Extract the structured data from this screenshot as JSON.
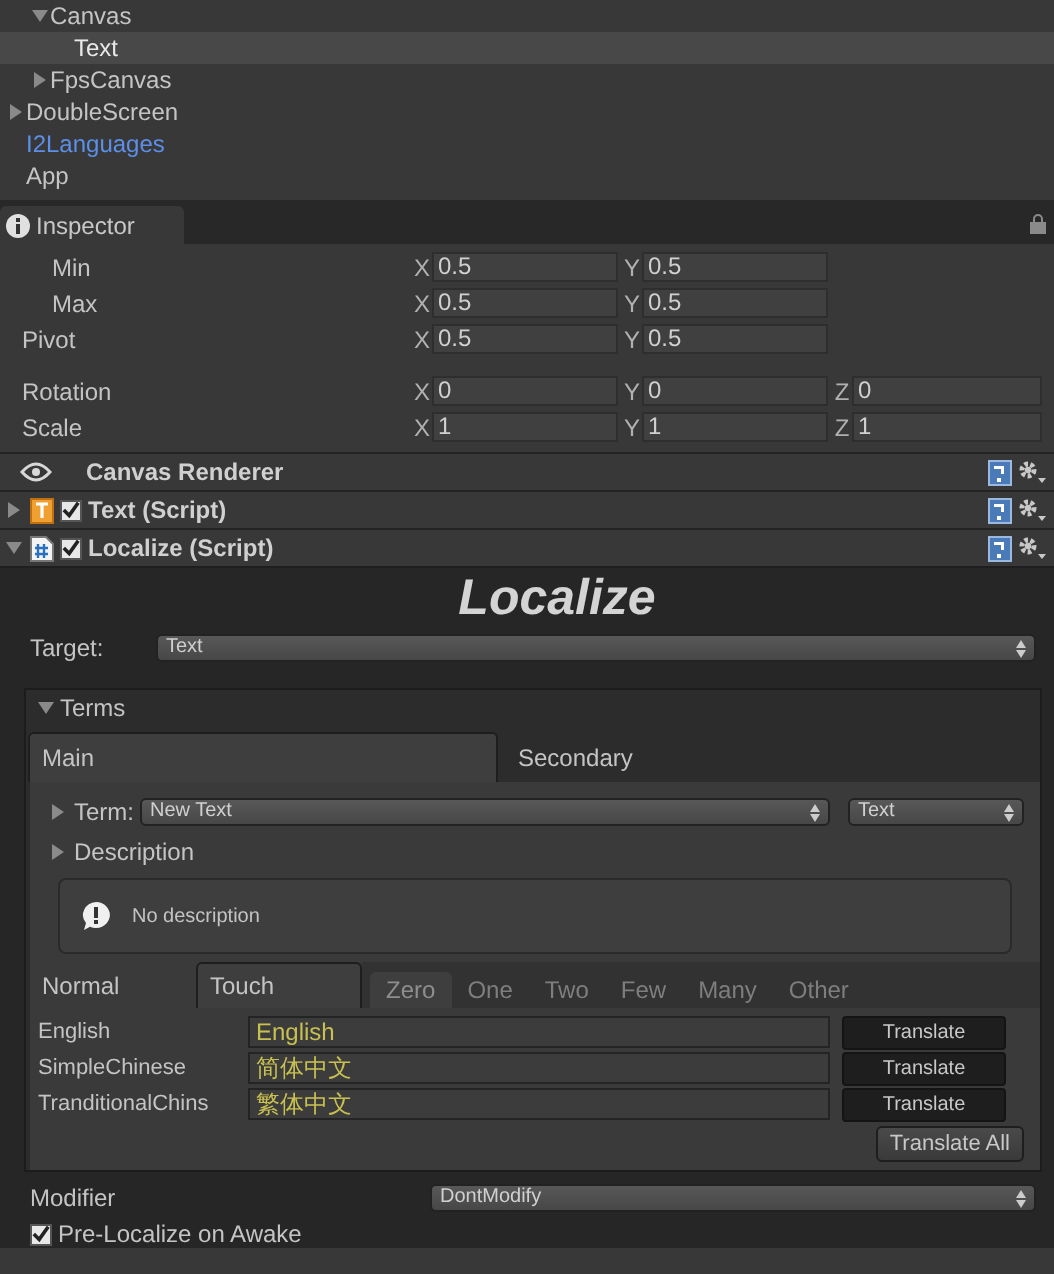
{
  "hierarchy": {
    "scrolled_children": [
      {
        "label": "Canvas",
        "expanded": true,
        "selected": false,
        "prefab": false,
        "children": [
          {
            "label": "Text",
            "selected": true,
            "prefab": false
          }
        ]
      },
      {
        "label": "FpsCanvas",
        "expanded": false,
        "selected": false,
        "prefab": false
      }
    ],
    "items": [
      {
        "label": "DoubleScreen",
        "expanded": false,
        "selected": false,
        "prefab": false
      },
      {
        "label": "I2Languages",
        "selected": false,
        "prefab": true
      },
      {
        "label": "App",
        "selected": false,
        "prefab": false
      }
    ]
  },
  "inspector_tab": {
    "label": "Inspector"
  },
  "transform_rows": [
    {
      "label": "Min",
      "indented": true,
      "fields": [
        {
          "axis": "X",
          "value": "0.5"
        },
        {
          "axis": "Y",
          "value": "0.5"
        }
      ]
    },
    {
      "label": "Max",
      "indented": true,
      "fields": [
        {
          "axis": "X",
          "value": "0.5"
        },
        {
          "axis": "Y",
          "value": "0.5"
        }
      ]
    },
    {
      "label": "Pivot",
      "indented": false,
      "fields": [
        {
          "axis": "X",
          "value": "0.5"
        },
        {
          "axis": "Y",
          "value": "0.5"
        }
      ]
    },
    {
      "label": "Rotation",
      "indented": false,
      "fields": [
        {
          "axis": "X",
          "value": "0"
        },
        {
          "axis": "Y",
          "value": "0"
        },
        {
          "axis": "Z",
          "value": "0"
        }
      ]
    },
    {
      "label": "Scale",
      "indented": false,
      "fields": [
        {
          "axis": "X",
          "value": "1"
        },
        {
          "axis": "Y",
          "value": "1"
        },
        {
          "axis": "Z",
          "value": "1"
        }
      ]
    }
  ],
  "components": [
    {
      "name": "Canvas Renderer",
      "kind": "renderer"
    },
    {
      "name": "Text (Script)",
      "kind": "text",
      "expanded": false,
      "enabled": true
    },
    {
      "name": "Localize (Script)",
      "kind": "script",
      "expanded": true,
      "enabled": true
    }
  ],
  "localize": {
    "title": "Localize",
    "target": {
      "label": "Target:",
      "value": "Text"
    },
    "terms": {
      "label": "Terms",
      "expanded": true,
      "tabs": [
        {
          "label": "Main",
          "selected": true
        },
        {
          "label": "Secondary",
          "selected": false
        }
      ],
      "term": {
        "label": "Term:",
        "value": "New Text",
        "type": "Text"
      },
      "description": {
        "label": "Description",
        "expanded": false
      },
      "help": "No description",
      "mode_tabs": [
        {
          "label": "Normal",
          "selected": false
        },
        {
          "label": "Touch",
          "selected": true
        }
      ],
      "plural_tabs": [
        {
          "label": "Zero",
          "selected": true
        },
        {
          "label": "One",
          "selected": false
        },
        {
          "label": "Two",
          "selected": false
        },
        {
          "label": "Few",
          "selected": false
        },
        {
          "label": "Many",
          "selected": false
        },
        {
          "label": "Other",
          "selected": false
        }
      ],
      "languages": [
        {
          "name": "English",
          "value": "English",
          "button": "Translate"
        },
        {
          "name": "SimpleChinese",
          "value": "简体中文",
          "button": "Translate"
        },
        {
          "name": "TranditionalChins",
          "value": "繁体中文",
          "button": "Translate"
        }
      ],
      "translate_all": "Translate All"
    },
    "modifier": {
      "label": "Modifier",
      "value": "DontModify"
    },
    "pre_localize": {
      "label": "Pre-Localize on Awake",
      "checked": true
    }
  }
}
